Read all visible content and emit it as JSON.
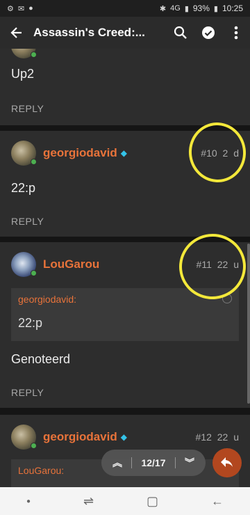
{
  "status": {
    "left_icons": [
      "⚙",
      "✉",
      "●"
    ],
    "battery": "93%",
    "time": "10:25",
    "signal": "4G"
  },
  "appbar": {
    "title": "Assassin's Creed:..."
  },
  "posts": [
    {
      "body": "Up2",
      "reply": "REPLY"
    },
    {
      "user": "georgiodavid",
      "meta": "#10 2 d",
      "body": "22:p",
      "reply": "REPLY"
    },
    {
      "user": "LouGarou",
      "meta": "#11 22 u",
      "quote_user": "georgiodavid:",
      "quote_text": "22:p",
      "body": "Genoteerd",
      "reply": "REPLY"
    },
    {
      "user": "georgiodavid",
      "meta": "#12 22 u",
      "quote_user": "LouGarou:"
    }
  ],
  "pager": {
    "label": "12/17"
  },
  "colors": {
    "username": "#e8733a",
    "annotation": "#f3e83a",
    "fab": "#b2471f"
  }
}
